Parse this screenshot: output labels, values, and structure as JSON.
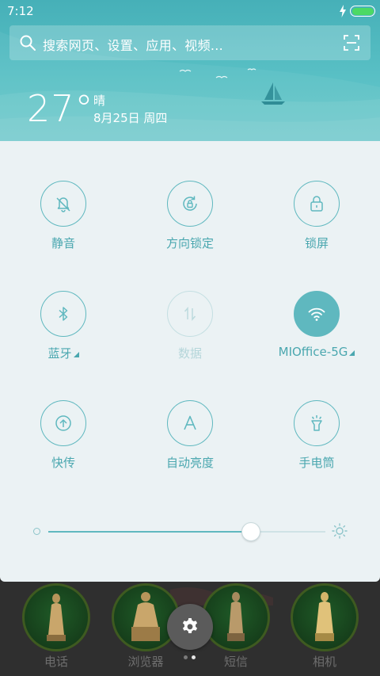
{
  "status_bar": {
    "time": "7:12",
    "battery_color": "#4cd964"
  },
  "search": {
    "placeholder": "搜索网页、设置、应用、视频..."
  },
  "weather": {
    "temperature": "27°",
    "condition": "晴",
    "date": "8月25日 周四"
  },
  "colors": {
    "accent": "#5fb8bf",
    "label": "#4aa7af",
    "panel_bg": "#ebf2f4",
    "header_top": "#46b0b8"
  },
  "quick_settings": {
    "tiles": [
      {
        "label": "静音",
        "icon": "bell-off-icon",
        "state": "off"
      },
      {
        "label": "方向锁定",
        "icon": "rotation-lock-icon",
        "state": "off"
      },
      {
        "label": "锁屏",
        "icon": "lock-icon",
        "state": "off"
      },
      {
        "label": "蓝牙",
        "icon": "bluetooth-icon",
        "state": "off",
        "has_submenu": true
      },
      {
        "label": "数据",
        "icon": "mobile-data-icon",
        "state": "disabled"
      },
      {
        "label": "MIOffice-5G",
        "icon": "wifi-icon",
        "state": "on",
        "has_submenu": true
      },
      {
        "label": "快传",
        "icon": "quick-share-icon",
        "state": "off"
      },
      {
        "label": "自动亮度",
        "icon": "auto-brightness-icon",
        "state": "off"
      },
      {
        "label": "手电筒",
        "icon": "flashlight-icon",
        "state": "off"
      }
    ],
    "brightness": {
      "level": 0.73
    }
  },
  "dock": {
    "apps": [
      {
        "label": "电话"
      },
      {
        "label": "浏览器"
      },
      {
        "label": "短信"
      },
      {
        "label": "相机"
      }
    ],
    "settings_icon": "gear-icon",
    "page_count": 2,
    "current_page": 2
  }
}
